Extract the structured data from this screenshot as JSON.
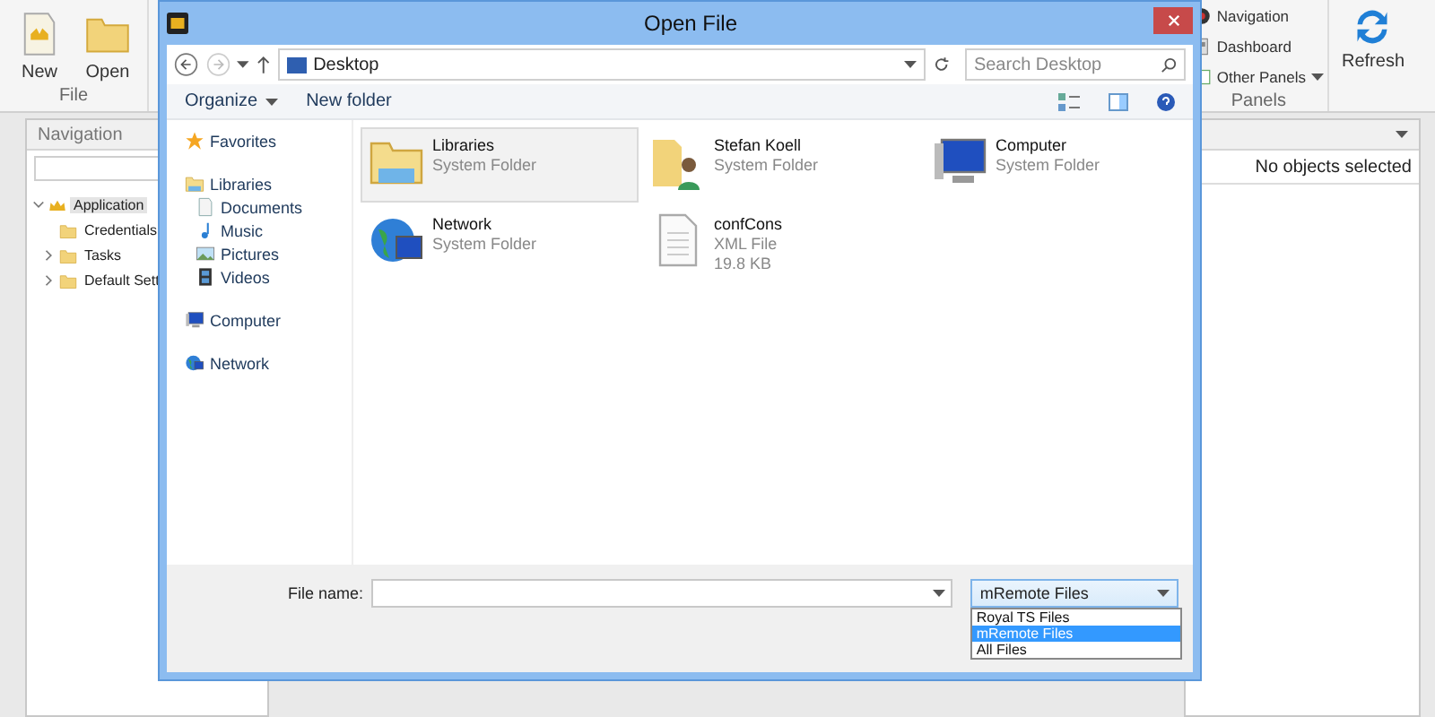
{
  "app": {
    "ribbon": {
      "file_group": {
        "label": "File",
        "buttons": [
          {
            "label": "New",
            "kind": "new"
          },
          {
            "label": "Open",
            "kind": "folder"
          }
        ]
      },
      "panels_group": {
        "label": "Panels",
        "items": [
          {
            "label": "Navigation",
            "kind": "nav",
            "caret": false
          },
          {
            "label": "Dashboard",
            "kind": "dash",
            "caret": false
          },
          {
            "label": "Other Panels",
            "kind": "panels",
            "caret": true
          }
        ],
        "refresh": "Refresh"
      }
    },
    "navigation": {
      "title": "Navigation",
      "tree": [
        {
          "label": "Application",
          "kind": "crown",
          "selected": true,
          "expanded": true,
          "children": [
            {
              "label": "Credentials",
              "kind": "folder",
              "selected": false
            },
            {
              "label": "Tasks",
              "kind": "folder",
              "selected": false,
              "expanded": false
            },
            {
              "label": "Default Sett",
              "kind": "folder",
              "selected": false,
              "expanded": false
            }
          ]
        }
      ]
    },
    "properties": {
      "status": "No objects selected"
    }
  },
  "dialog": {
    "title": "Open File",
    "address": "Desktop",
    "search_placeholder": "Search Desktop",
    "toolbar": [
      {
        "label": "Organize",
        "caret": true
      },
      {
        "label": "New folder",
        "caret": false
      }
    ],
    "nav_pane": [
      {
        "label": "Favorites",
        "kind": "star"
      },
      {
        "label": "Libraries",
        "kind": "library",
        "children": [
          {
            "label": "Documents",
            "kind": "documents"
          },
          {
            "label": "Music",
            "kind": "music"
          },
          {
            "label": "Pictures",
            "kind": "pictures"
          },
          {
            "label": "Videos",
            "kind": "videos"
          }
        ]
      },
      {
        "label": "Computer",
        "kind": "computer"
      },
      {
        "label": "Network",
        "kind": "network"
      }
    ],
    "items": [
      {
        "name": "Libraries",
        "details": [
          "System Folder"
        ],
        "kind": "library",
        "selected": true
      },
      {
        "name": "Stefan Koell",
        "details": [
          "System Folder"
        ],
        "kind": "user-folder",
        "selected": false
      },
      {
        "name": "Computer",
        "details": [
          "System Folder"
        ],
        "kind": "computer",
        "selected": false
      },
      {
        "name": "Network",
        "details": [
          "System Folder"
        ],
        "kind": "network",
        "selected": false
      },
      {
        "name": "confCons",
        "details": [
          "XML File",
          "19.8 KB"
        ],
        "kind": "file",
        "selected": false
      }
    ],
    "file_name_label": "File name:",
    "file_type": "mRemote Files",
    "file_type_open": true,
    "file_type_options": [
      {
        "label": "Royal TS Files",
        "selected": false
      },
      {
        "label": "mRemote Files",
        "selected": true
      },
      {
        "label": "All Files",
        "selected": false
      }
    ]
  }
}
